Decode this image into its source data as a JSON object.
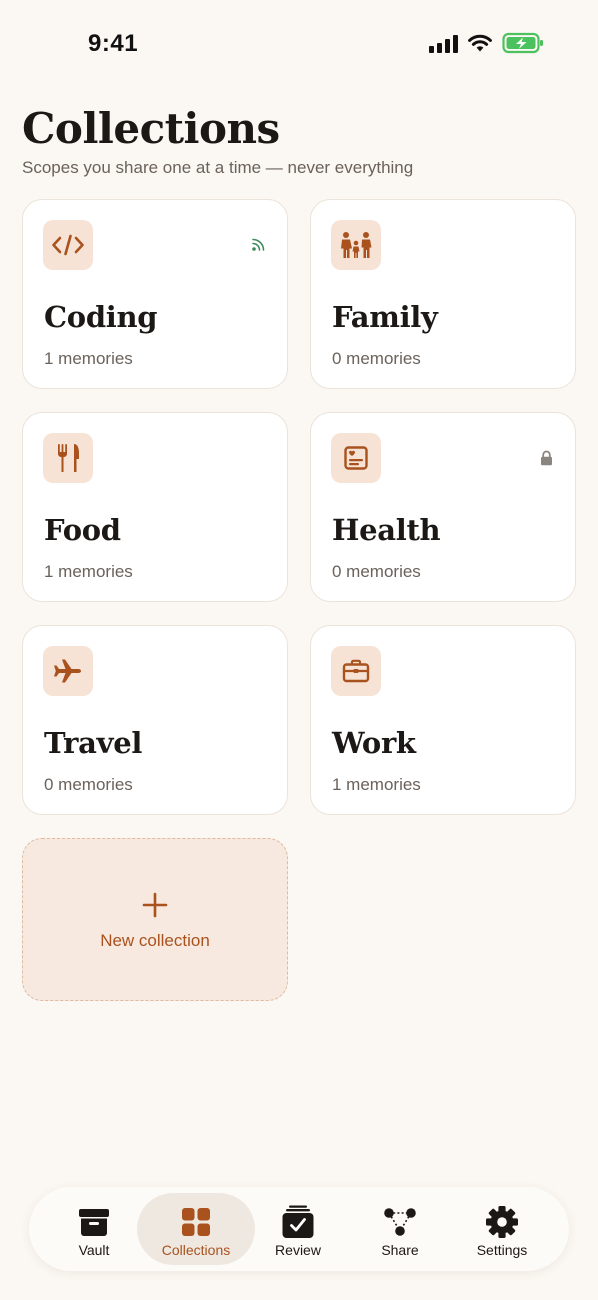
{
  "status_bar": {
    "time": "9:41"
  },
  "header": {
    "title": "Collections",
    "subtitle": "Scopes you share one at a time — never everything"
  },
  "collections": [
    {
      "name": "Coding",
      "count": "1 memories",
      "icon": "code-icon",
      "badge": "rss-icon"
    },
    {
      "name": "Family",
      "count": "0 memories",
      "icon": "family-icon",
      "badge": ""
    },
    {
      "name": "Food",
      "count": "1 memories",
      "icon": "fork-knife-icon",
      "badge": ""
    },
    {
      "name": "Health",
      "count": "0 memories",
      "icon": "health-record-icon",
      "badge": "lock-icon"
    },
    {
      "name": "Travel",
      "count": "0 memories",
      "icon": "airplane-icon",
      "badge": ""
    },
    {
      "name": "Work",
      "count": "1 memories",
      "icon": "briefcase-icon",
      "badge": ""
    }
  ],
  "new_collection": {
    "label": "New collection",
    "icon": "plus-icon"
  },
  "tabbar": {
    "items": [
      {
        "label": "Vault",
        "icon": "archive-box-icon",
        "active": false
      },
      {
        "label": "Collections",
        "icon": "grid-icon",
        "active": true
      },
      {
        "label": "Review",
        "icon": "review-stack-icon",
        "active": false
      },
      {
        "label": "Share",
        "icon": "share-nodes-icon",
        "active": false
      },
      {
        "label": "Settings",
        "icon": "gear-icon",
        "active": false
      }
    ]
  },
  "colors": {
    "background": "#fbf7f2",
    "accent": "#a9521e",
    "icon_tile": "#f6e3d6",
    "rss_green": "#3f8a5a",
    "battery_green": "#4cc25e"
  }
}
